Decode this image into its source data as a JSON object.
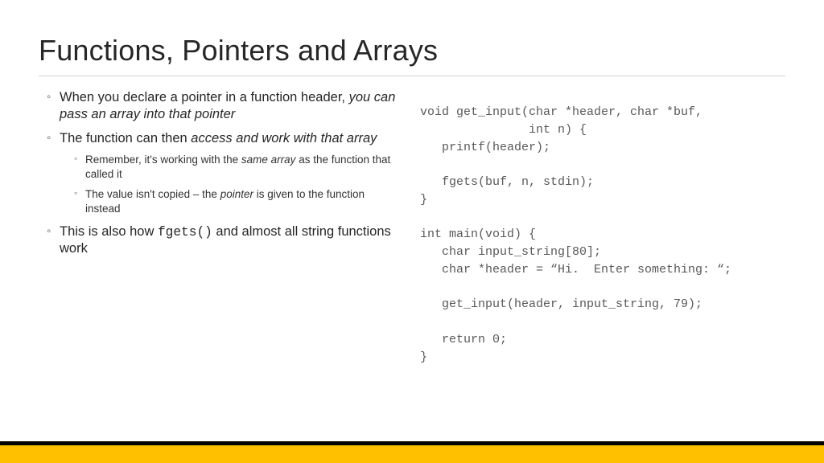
{
  "title": "Functions, Pointers and Arrays",
  "bullets": {
    "b1_pre": "When you declare a pointer in a function header, ",
    "b1_em": "you can pass an array into that pointer",
    "b2_pre": "The function can then ",
    "b2_em": "access and work with that array",
    "b2_sub1_pre": "Remember, it's working with the ",
    "b2_sub1_em": "same array",
    "b2_sub1_post": " as the function that called it",
    "b2_sub2_pre": "The value isn't copied – the ",
    "b2_sub2_em": "pointer",
    "b2_sub2_post": " is given to the function instead",
    "b3_pre": "This is also how ",
    "b3_code": "fgets()",
    "b3_post": " and almost all string functions work"
  },
  "code": "void get_input(char *header, char *buf,\n               int n) {\n   printf(header);\n\n   fgets(buf, n, stdin);\n}\n\nint main(void) {\n   char input_string[80];\n   char *header = “Hi.  Enter something: “;\n\n   get_input(header, input_string, 79);\n\n   return 0;\n}"
}
